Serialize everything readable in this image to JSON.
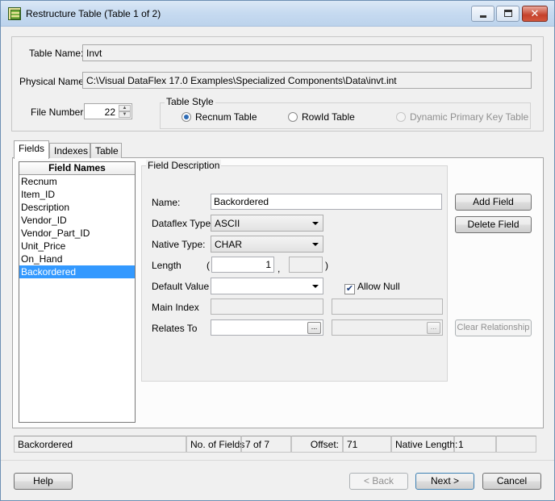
{
  "window": {
    "title": "Restructure Table (Table 1 of 2)",
    "controls": {
      "minimize": "minimize",
      "maximize": "maximize",
      "close": "✕"
    }
  },
  "table_info": {
    "table_name_label": "Table Name:",
    "table_name_value": "Invt",
    "physical_name_label": "Physical Name:",
    "physical_name_value": "C:\\Visual DataFlex 17.0 Examples\\Specialized Components\\Data\\invt.int",
    "file_number_label": "File Number:",
    "file_number_value": "22"
  },
  "table_style": {
    "title": "Table Style",
    "options": [
      {
        "label": "Recnum Table",
        "selected": true,
        "enabled": true
      },
      {
        "label": "RowId Table",
        "selected": false,
        "enabled": true
      },
      {
        "label": "Dynamic Primary Key Table",
        "selected": false,
        "enabled": false
      }
    ]
  },
  "tabs": [
    {
      "label": "Fields",
      "active": true
    },
    {
      "label": "Indexes",
      "active": false
    },
    {
      "label": "Table",
      "active": false
    }
  ],
  "field_list": {
    "header": "Field Names",
    "items": [
      "Recnum",
      "Item_ID",
      "Description",
      "Vendor_ID",
      "Vendor_Part_ID",
      "Unit_Price",
      "On_Hand",
      "Backordered"
    ],
    "selected_index": 7
  },
  "field_description": {
    "title": "Field Description",
    "name_label": "Name:",
    "name_value": "Backordered",
    "dataflex_type_label": "Dataflex Type:",
    "dataflex_type_value": "ASCII",
    "native_type_label": "Native Type:",
    "native_type_value": "CHAR",
    "length_label": "Length",
    "length_open_paren": "(",
    "length_value": "1",
    "length_separator": ",",
    "precision_value": "",
    "length_close_paren": ")",
    "default_value_label": "Default Value",
    "default_value": "",
    "allow_null_label": "Allow Null",
    "allow_null_checked": true,
    "check_mark": "✔",
    "main_index_label": "Main Index",
    "main_index_value": "",
    "main_index_value2": "",
    "relates_to_label": "Relates To",
    "relates_to_value": "",
    "relates_to_value2": "",
    "ellipsis": "..."
  },
  "side_buttons": {
    "add_field": "Add Field",
    "delete_field": "Delete Field",
    "clear_relationship": "Clear Relationship"
  },
  "status_bar": {
    "current_field": "Backordered",
    "num_fields_label": "No. of Fields",
    "num_fields_value": "7 of 7",
    "offset_label": "Offset:",
    "offset_value": "71",
    "native_length_label": "Native Length:",
    "native_length_value": "1"
  },
  "footer_buttons": {
    "help": "Help",
    "back": "< Back",
    "next": "Next >",
    "cancel": "Cancel"
  }
}
